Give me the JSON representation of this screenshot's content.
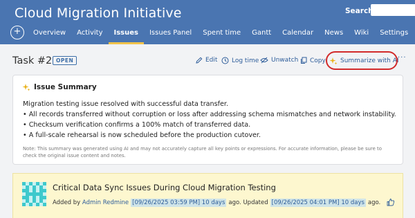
{
  "header": {
    "project_title": "Cloud Migration Initiative",
    "search_label": "Search:",
    "tabs": [
      {
        "label": "Overview"
      },
      {
        "label": "Activity"
      },
      {
        "label": "Issues"
      },
      {
        "label": "Issues Panel"
      },
      {
        "label": "Spent time"
      },
      {
        "label": "Gantt"
      },
      {
        "label": "Calendar"
      },
      {
        "label": "News"
      },
      {
        "label": "Wiki"
      },
      {
        "label": "Settings"
      }
    ],
    "active_tab": "Issues"
  },
  "task": {
    "title": "Task #2",
    "status_badge": "OPEN",
    "actions": {
      "edit": "Edit",
      "log_time": "Log time",
      "unwatch": "Unwatch",
      "copy": "Copy",
      "summarize": "Summarize with AI",
      "more": "···"
    }
  },
  "summary": {
    "heading": "Issue Summary",
    "lines": [
      "Migration testing issue resolved with successful data transfer.",
      "• All records transferred without corruption or loss after addressing schema mismatches and network instability.",
      "• Checksum verification confirms a 100% match of transferred data.",
      "• A full-scale rehearsal is now scheduled before the production cutover."
    ],
    "note": "Note: This summary was generated using AI and may not accurately capture all key points or expressions. For accurate information, please be sure to check the original issue content and notes."
  },
  "issue": {
    "subject": "Critical Data Sync Issues During Cloud Migration Testing",
    "added_by_prefix": "Added by",
    "author": "Admin Redmine",
    "created": "[09/26/2025 03:59 PM] 10 days",
    "ago_updated": "ago. Updated",
    "updated": "[09/26/2025 04:01 PM] 10 days",
    "ago": "ago."
  },
  "colors": {
    "header_bg": "#4a75b1",
    "active_tab_underline": "#f0c24a",
    "link": "#2e5d9a",
    "highlight_ring": "#d22a2a",
    "issue_bg": "#fdf7cf"
  }
}
